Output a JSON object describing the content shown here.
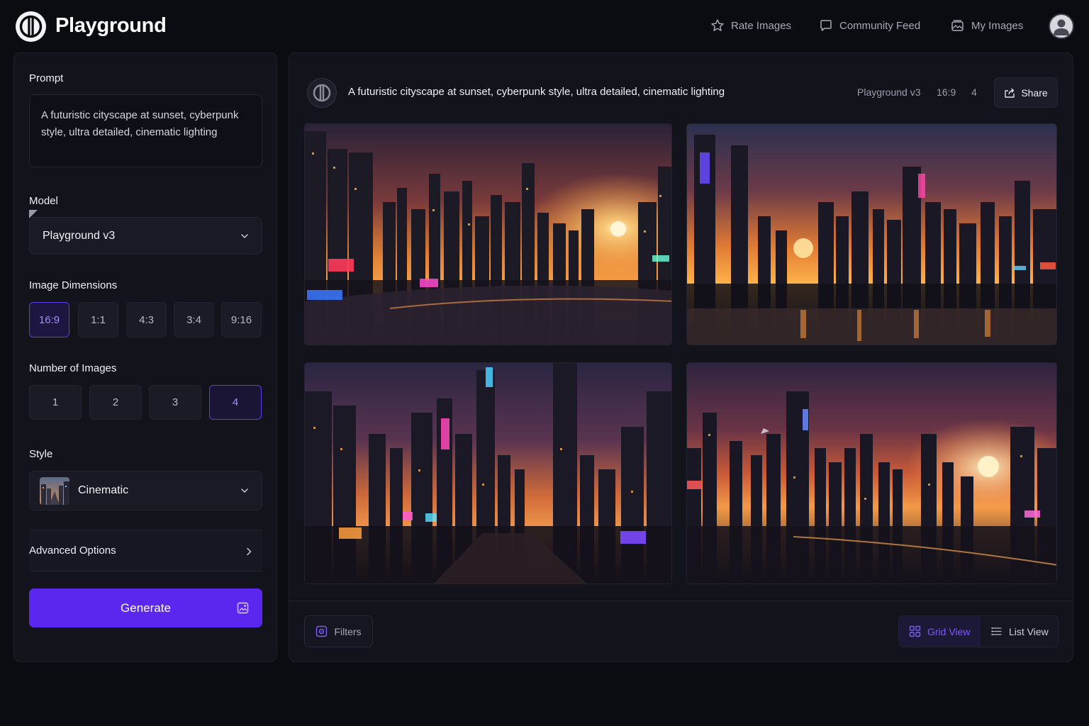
{
  "app": {
    "name": "Playground"
  },
  "nav": {
    "rate_images": "Rate Images",
    "community_feed": "Community Feed",
    "my_images": "My Images"
  },
  "sidebar": {
    "prompt_label": "Prompt",
    "prompt_value": "A futuristic cityscape at sunset, cyberpunk style, ultra detailed, cinematic lighting",
    "model_label": "Model",
    "model_value": "Playground v3",
    "dimensions_label": "Image Dimensions",
    "dimensions": [
      "16:9",
      "1:1",
      "4:3",
      "3:4",
      "9:16"
    ],
    "dimensions_selected": "16:9",
    "num_images_label": "Number of Images",
    "num_images": [
      "1",
      "2",
      "3",
      "4"
    ],
    "num_images_selected": "4",
    "style_label": "Style",
    "style_value": "Cinematic",
    "advanced_label": "Advanced Options",
    "generate_label": "Generate"
  },
  "results": {
    "prompt": "A futuristic cityscape at sunset, cyberpunk style, ultra detailed, cinematic lighting",
    "model": "Playground v3",
    "ratio": "16:9",
    "count": "4",
    "share_label": "Share",
    "filters_label": "Filters",
    "grid_view_label": "Grid View",
    "list_view_label": "List View"
  },
  "colors": {
    "accent": "#5b27ef",
    "accent_text": "#a58cff",
    "background": "#0b0b12",
    "panel": "#13131c"
  }
}
